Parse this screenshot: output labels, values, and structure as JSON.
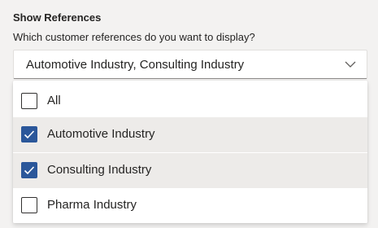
{
  "filter": {
    "title": "Show References",
    "question": "Which customer references do you want to display?",
    "selected_value": "Automotive Industry, Consulting Industry",
    "options": [
      {
        "label": "All",
        "checked": false
      },
      {
        "label": "Automotive Industry",
        "checked": true
      },
      {
        "label": "Consulting Industry",
        "checked": true
      },
      {
        "label": "Pharma Industry",
        "checked": false
      }
    ]
  },
  "colors": {
    "accent": "#2b579a",
    "selected_row": "#edebe9",
    "background": "#f3f2f1",
    "text": "#252423"
  },
  "icons": {
    "dropdown": "chevron-down-icon",
    "check": "checkmark-icon"
  }
}
